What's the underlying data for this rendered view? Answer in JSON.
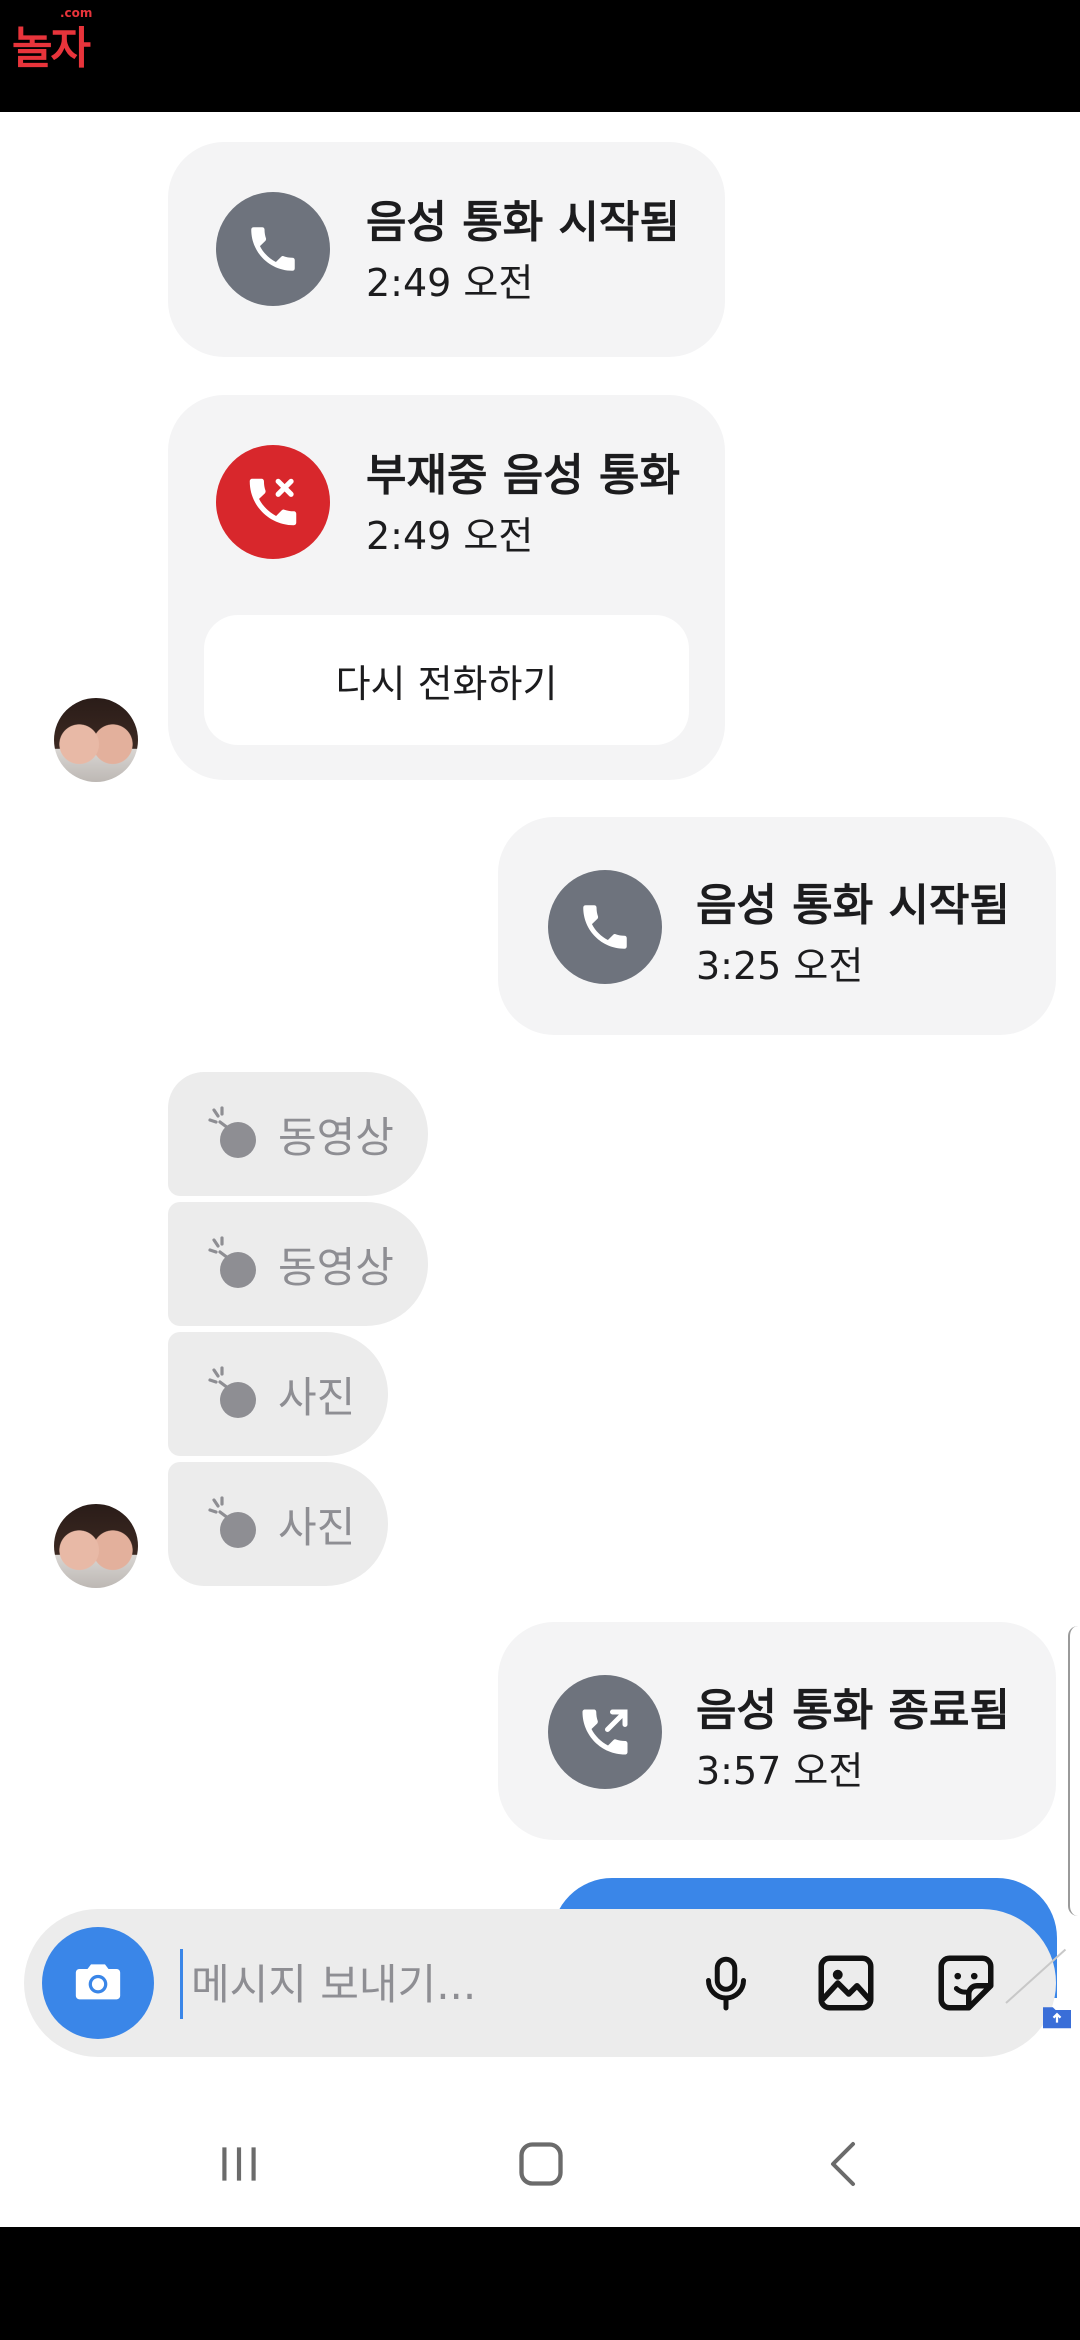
{
  "watermark": {
    "logo_text": "놀자",
    "logo_small": ".com"
  },
  "messages": [
    {
      "type": "call",
      "title": "음성 통화 시작됨",
      "time": "2:49 오전"
    },
    {
      "type": "missed_call",
      "title": "부재중 음성 통화",
      "time": "2:49 오전",
      "action_label": "다시 전화하기"
    },
    {
      "type": "call",
      "title": "음성 통화 시작됨",
      "time": "3:25 오전"
    },
    {
      "type": "media",
      "label": "동영상"
    },
    {
      "type": "media",
      "label": "동영상"
    },
    {
      "type": "media",
      "label": "사진"
    },
    {
      "type": "media",
      "label": "사진"
    },
    {
      "type": "call_ended",
      "title": "음성 통화 종료됨",
      "time": "3:57 오전"
    }
  ],
  "composer": {
    "placeholder": "메시지 보내기..."
  },
  "colors": {
    "accent": "#3a86e8",
    "missed": "#d8272c",
    "call_icon": "#6e737d",
    "bubble": "#f4f4f5"
  }
}
